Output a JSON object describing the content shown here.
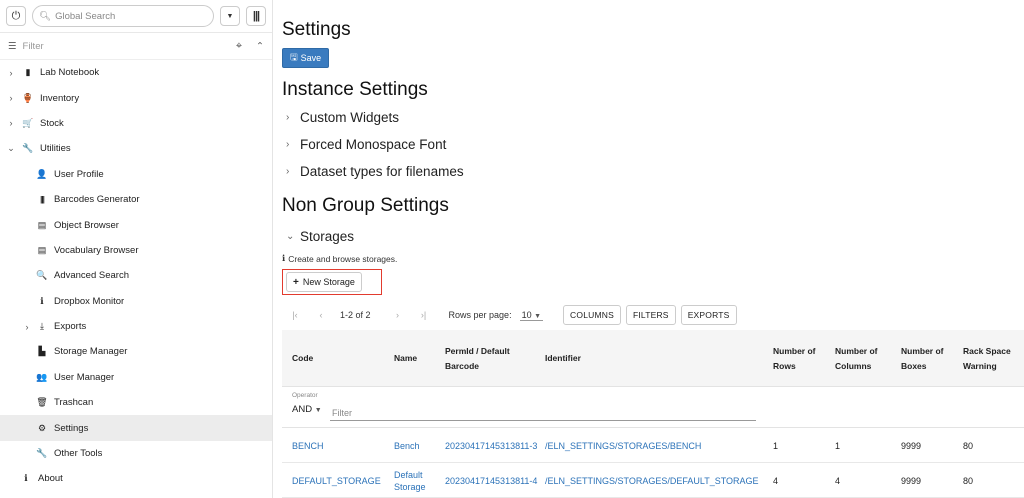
{
  "search": {
    "placeholder": "Global Search"
  },
  "filter": {
    "placeholder": "Filter"
  },
  "sidebar": {
    "items": [
      {
        "label": "Lab Notebook",
        "chev": "›",
        "icon": "▮"
      },
      {
        "label": "Inventory",
        "chev": "›",
        "icon": "🏺"
      },
      {
        "label": "Stock",
        "chev": "›",
        "icon": "🛒"
      },
      {
        "label": "Utilities",
        "chev": "⌄",
        "icon": "🔧"
      },
      {
        "label": "User Profile",
        "icon": "👤"
      },
      {
        "label": "Barcodes Generator",
        "icon": "|||"
      },
      {
        "label": "Object Browser",
        "icon": "▤"
      },
      {
        "label": "Vocabulary Browser",
        "icon": "▤"
      },
      {
        "label": "Advanced Search",
        "icon": "🔍"
      },
      {
        "label": "Dropbox Monitor",
        "icon": "ℹ"
      },
      {
        "label": "Exports",
        "chev": "›",
        "icon": "⤓"
      },
      {
        "label": "Storage Manager",
        "icon": "▙"
      },
      {
        "label": "User Manager",
        "icon": "👥"
      },
      {
        "label": "Trashcan",
        "icon": "🗑"
      },
      {
        "label": "Settings",
        "icon": "⚙"
      },
      {
        "label": "Other Tools",
        "icon": "🔧"
      },
      {
        "label": "About",
        "icon": "ℹ"
      }
    ]
  },
  "header": {
    "title": "Settings",
    "save_label": "Save"
  },
  "instance": {
    "title": "Instance Settings",
    "sections": [
      "Custom Widgets",
      "Forced Monospace Font",
      "Dataset types for filenames"
    ]
  },
  "nongroup": {
    "title": "Non Group Settings",
    "storages_label": "Storages",
    "description": "Create and browse storages.",
    "new_button": "New Storage"
  },
  "pager": {
    "range": "1-2 of 2",
    "rows_per_page_label": "Rows per page:",
    "rows_per_page": "10",
    "columns_btn": "COLUMNS",
    "filters_btn": "FILTERS",
    "exports_btn": "EXPORTS"
  },
  "table": {
    "headers": {
      "code": "Code",
      "name": "Name",
      "permid": "PermId / Default Barcode",
      "identifier": "Identifier",
      "rows": "Number of Rows",
      "columns": "Number of Columns",
      "boxes": "Number of Boxes",
      "rack": "Rack Space Warning"
    },
    "operator_label": "Operator",
    "operator": "AND",
    "filter_placeholder": "Filter",
    "rows": [
      {
        "code": "BENCH",
        "name": "Bench",
        "permid": "20230417145313811-3",
        "identifier": "/ELN_SETTINGS/STORAGES/BENCH",
        "rows": "1",
        "columns": "1",
        "boxes": "9999",
        "rack": "80"
      },
      {
        "code": "DEFAULT_STORAGE",
        "name": "Default Storage",
        "permid": "20230417145313811-4",
        "identifier": "/ELN_SETTINGS/STORAGES/DEFAULT_STORAGE",
        "rows": "4",
        "columns": "4",
        "boxes": "9999",
        "rack": "80"
      }
    ]
  }
}
